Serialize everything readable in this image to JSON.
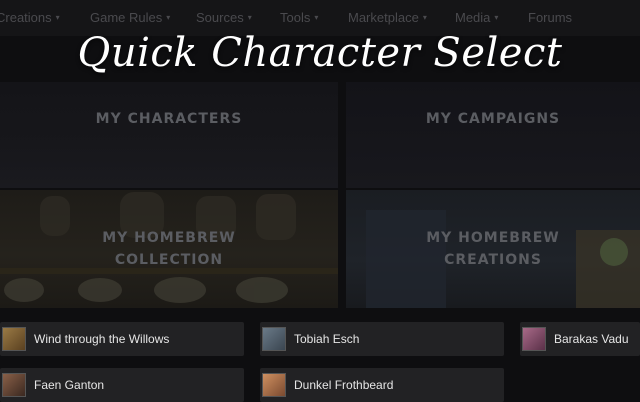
{
  "nav": {
    "items": [
      {
        "label": "Creations",
        "caret": "▾"
      },
      {
        "label": "Game Rules",
        "caret": "▾"
      },
      {
        "label": "Sources",
        "caret": "▾"
      },
      {
        "label": "Tools",
        "caret": "▾"
      },
      {
        "label": "Marketplace",
        "caret": "▾"
      },
      {
        "label": "Media",
        "caret": "▾"
      },
      {
        "label": "Forums",
        "caret": ""
      }
    ]
  },
  "title": "Quick Character Select",
  "tiles": {
    "my_characters": "MY CHARACTERS",
    "my_campaigns": "MY CAMPAIGNS",
    "homebrew_collection": "MY HOMEBREW\nCOLLECTION",
    "homebrew_creations": "MY HOMEBREW\nCREATIONS"
  },
  "characters": [
    {
      "name": "Wind through the Willows",
      "avatar_color": "#7a5a30"
    },
    {
      "name": "Tobiah Esch",
      "avatar_color": "#5a6a78"
    },
    {
      "name": "Barakas Vadu",
      "avatar_color": "#8a5a70"
    },
    {
      "name": "Faen Ganton",
      "avatar_color": "#6a4a38"
    },
    {
      "name": "Dunkel Frothbeard",
      "avatar_color": "#b07850"
    }
  ],
  "colors": {
    "background": "#0e0e10",
    "tile_label": "#5b5d62",
    "row_background": "#222224",
    "title": "#ffffff"
  }
}
